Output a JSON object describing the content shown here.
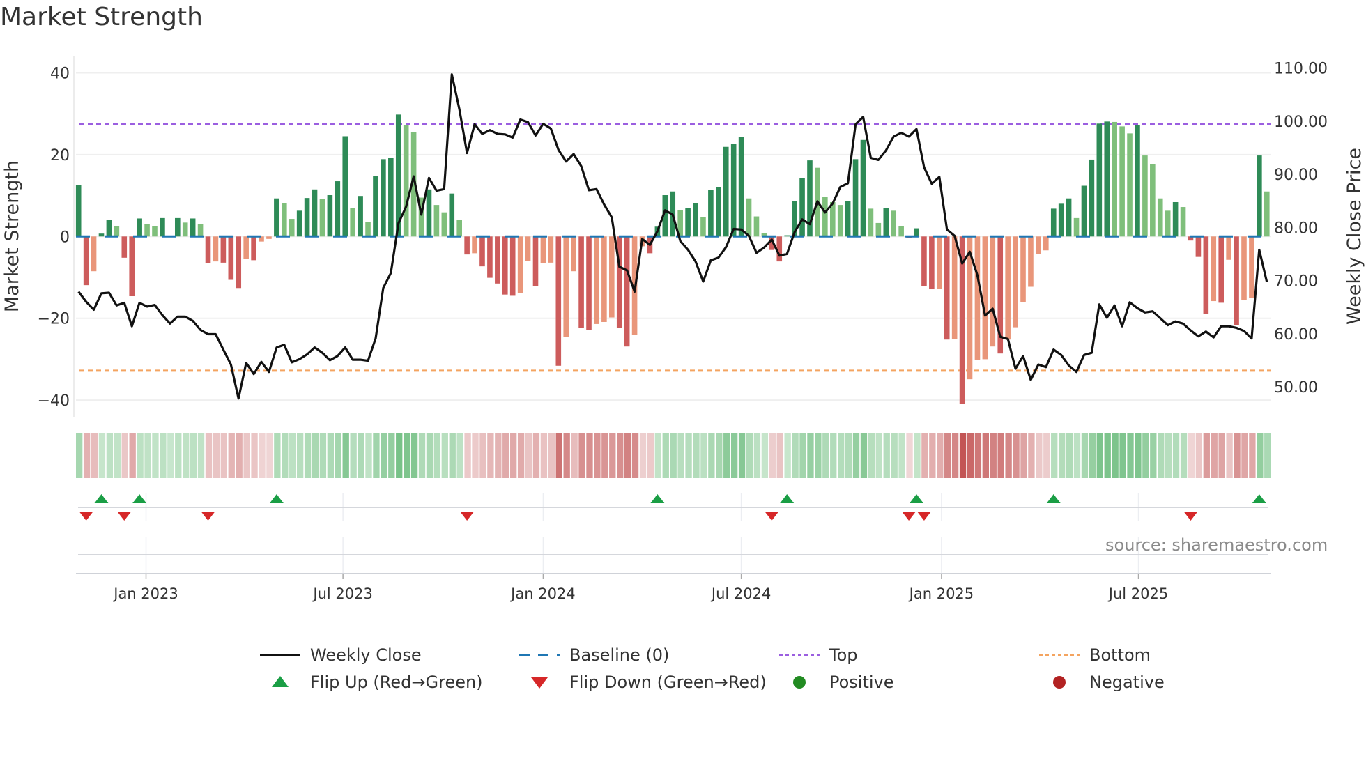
{
  "title": "Market Strength",
  "source": "source: sharemaestro.com",
  "colors": {
    "rising_positive": "#2e8b57",
    "falling_positive": "#7fbf7b",
    "falling_negative": "#cd5c5c",
    "rising_negative": "#e9967a",
    "price_line": "#111111",
    "baseline": "#1f77b4",
    "top": "#9b5fe0",
    "bottom": "#f4a460",
    "flip_up": "#1a9e45",
    "flip_down": "#d62728",
    "positive": "#228b22",
    "negative": "#b22222"
  },
  "legend": [
    {
      "label": "Weekly Close",
      "icon": "solid-line"
    },
    {
      "label": "Baseline (0)",
      "icon": "dashed-line"
    },
    {
      "label": "Top",
      "icon": "dotted-line"
    },
    {
      "label": "Bottom",
      "icon": "dotted-line"
    },
    {
      "label": "Flip Up (Red→Green)",
      "icon": "triangle-up"
    },
    {
      "label": "Flip Down (Green→Red)",
      "icon": "triangle-down"
    },
    {
      "label": "Positive",
      "icon": "circle"
    },
    {
      "label": "Negative",
      "icon": "circle"
    }
  ],
  "chart_data": {
    "type": "bar",
    "title": "Market Strength",
    "ylabel": "Market Strength",
    "y2label": "Weekly Close Price",
    "ylim": [
      -44,
      44
    ],
    "y2lim": [
      45.6,
      110.4
    ],
    "yticks": [
      40,
      20,
      0,
      -20,
      -40
    ],
    "ytick_labels": [
      "40",
      "20",
      "0",
      "−20",
      "−40"
    ],
    "y2ticks": [
      110,
      100,
      90,
      80,
      70,
      60,
      50
    ],
    "y2tick_labels": [
      "110.00",
      "100.00",
      "90.00",
      "80.00",
      "70.00",
      "60.00",
      "50.00"
    ],
    "xticks": [
      "2023-01-01",
      "2023-07-01",
      "2024-01-01",
      "2024-07-01",
      "2025-01-01",
      "2025-07-01"
    ],
    "xtick_labels": [
      "Jan 2023",
      "Jul 2023",
      "Jan 2024",
      "Jul 2024",
      "Jan 2025",
      "Jul 2025"
    ],
    "first_week": "2022-10-31",
    "frequency": "weekly",
    "top_level": 27.4,
    "bottom_level": -32.8,
    "strength": [
      12.5,
      -11.9,
      -8.5,
      0.7,
      4.1,
      2.6,
      -5.2,
      -14.6,
      4.4,
      3.1,
      2.6,
      4.5,
      0.2,
      4.5,
      3.4,
      4.4,
      3.1,
      -6.5,
      -6.1,
      -6.4,
      -10.6,
      -12.6,
      -5.4,
      -5.8,
      -1.25,
      -0.6,
      9.3,
      8.1,
      4.3,
      6.3,
      9.4,
      11.5,
      9.2,
      10.1,
      13.5,
      24.5,
      7.0,
      9.9,
      3.5,
      14.7,
      18.9,
      19.3,
      29.8,
      27.3,
      25.5,
      9.5,
      11.5,
      7.7,
      5.9,
      10.5,
      4.1,
      -4.4,
      -4.1,
      -7.3,
      -10.1,
      -11.5,
      -14.2,
      -14.5,
      -13.8,
      -6.0,
      -12.2,
      -6.5,
      -6.4,
      -31.6,
      -24.5,
      -8.5,
      -22.4,
      -22.8,
      -21.4,
      -20.9,
      -19.8,
      -22.4,
      -26.9,
      -24.1,
      -2.4,
      -4.1,
      2.4,
      10.1,
      11.0,
      6.5,
      7.0,
      8.2,
      4.8,
      11.3,
      12.1,
      21.9,
      22.6,
      24.3,
      9.3,
      4.9,
      0.8,
      -3.3,
      -6.1,
      0.3,
      8.7,
      14.3,
      18.6,
      16.8,
      9.7,
      8.4,
      7.7,
      8.7,
      18.9,
      23.6,
      6.8,
      3.3,
      7.0,
      6.3,
      2.6,
      -0.3,
      2.0,
      -12.2,
      -12.9,
      -12.8,
      -25.2,
      -25.1,
      -40.9,
      -34.9,
      -30.1,
      -30.0,
      -26.9,
      -28.6,
      -25.2,
      -22.2,
      -16.0,
      -12.3,
      -4.3,
      -3.4,
      6.8,
      8.0,
      9.3,
      4.5,
      12.4,
      18.8,
      27.6,
      28.1,
      28.0,
      26.9,
      25.2,
      27.3,
      19.8,
      17.6,
      9.3,
      6.3,
      8.4,
      7.2,
      -1.0,
      -5.0,
      -19.0,
      -15.8,
      -16.2,
      -5.7,
      -21.6,
      -15.5,
      -15.1,
      19.8,
      11.0
    ],
    "weekly_close": [
      67.9,
      66.0,
      64.5,
      67.6,
      67.7,
      65.3,
      65.8,
      61.4,
      65.8,
      65.1,
      65.4,
      63.5,
      61.9,
      63.2,
      63.2,
      62.4,
      60.7,
      59.9,
      59.9,
      57.0,
      54.2,
      47.8,
      54.5,
      52.4,
      54.7,
      52.8,
      57.4,
      57.9,
      54.6,
      55.2,
      56.1,
      57.4,
      56.4,
      55.0,
      55.8,
      57.4,
      55.1,
      55.1,
      54.9,
      59.1,
      68.6,
      71.4,
      80.8,
      83.9,
      89.6,
      82.4,
      89.3,
      86.9,
      87.2,
      108.8,
      102.2,
      94.0,
      99.4,
      97.6,
      98.3,
      97.6,
      97.5,
      96.9,
      100.3,
      99.8,
      97.3,
      99.5,
      98.6,
      94.6,
      92.4,
      93.8,
      91.5,
      87.0,
      87.2,
      84.3,
      81.9,
      72.6,
      71.9,
      67.9,
      77.8,
      76.7,
      79.3,
      83.2,
      82.4,
      77.4,
      75.8,
      73.6,
      69.8,
      73.8,
      74.3,
      76.3,
      79.7,
      79.6,
      78.4,
      75.2,
      76.2,
      77.7,
      74.7,
      75.0,
      79.1,
      81.5,
      80.6,
      84.9,
      82.8,
      84.5,
      87.6,
      88.3,
      99.4,
      100.8,
      93.1,
      92.7,
      94.5,
      97.1,
      97.8,
      97.1,
      98.5,
      91.3,
      88.2,
      89.5,
      79.6,
      78.4,
      73.2,
      75.4,
      71.0,
      63.4,
      64.7,
      59.4,
      59.0,
      53.4,
      55.8,
      51.3,
      54.2,
      53.7,
      57.0,
      56.0,
      54.0,
      52.8,
      56.0,
      56.4,
      65.5,
      63.0,
      65.3,
      61.4,
      65.9,
      64.8,
      64.0,
      64.2,
      62.9,
      61.6,
      62.3,
      61.9,
      60.6,
      59.5,
      60.4,
      59.3,
      61.4,
      61.4,
      61.1,
      60.5,
      59.1,
      75.8,
      69.7
    ]
  }
}
